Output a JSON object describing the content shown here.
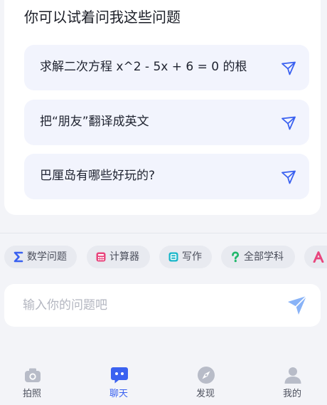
{
  "suggestions_card": {
    "title": "你可以试着问我这些问题",
    "items": [
      {
        "text": "求解二次方程 x^2 - 5x + 6 = 0 的根",
        "icon": "send-icon"
      },
      {
        "text": "把“朋友”翻译成英文",
        "icon": "send-icon"
      },
      {
        "text": "巴厘岛有哪些好玩的?",
        "icon": "send-icon"
      }
    ]
  },
  "chips": [
    {
      "label": "数学问题",
      "icon": "sigma-icon",
      "color": "#3a61f0"
    },
    {
      "label": "计算器",
      "icon": "calculator-icon",
      "color": "#e8457d"
    },
    {
      "label": "写作",
      "icon": "write-icon",
      "color": "#19b6c9"
    },
    {
      "label": "全部学科",
      "icon": "question-icon",
      "color": "#1fb76a"
    },
    {
      "label": "",
      "icon": "letter-a-icon",
      "color": "#e8457d"
    }
  ],
  "input": {
    "placeholder": "输入你的问题吧",
    "value": "",
    "send_icon": "send-icon"
  },
  "tabbar": {
    "tabs": [
      {
        "label": "拍照",
        "icon": "camera-icon",
        "active": false
      },
      {
        "label": "聊天",
        "icon": "chat-icon",
        "active": true
      },
      {
        "label": "发现",
        "icon": "compass-icon",
        "active": false
      },
      {
        "label": "我的",
        "icon": "user-icon",
        "active": false
      }
    ]
  },
  "colors": {
    "accent": "#3a61f0",
    "icon_inactive": "#b8bcc8",
    "suggestion_bg": "#f2f4fd",
    "page_bg": "#f3f4f8"
  }
}
